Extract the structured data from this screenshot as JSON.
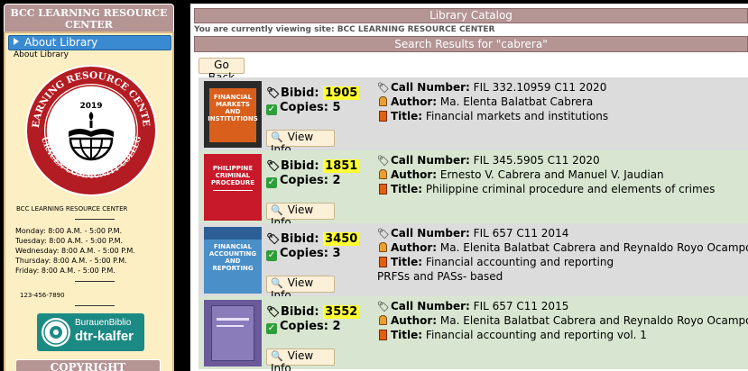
{
  "sidebar": {
    "title": "BCC LEARNING RESOURCE CENTER",
    "about_tab": "About Library",
    "about_link": "About Library",
    "logo_year": "2019",
    "logo_top_text": "LEARNING RESOURCE CENTER",
    "logo_bottom_text": "BURAUEN COMMUNITY COLLEGE",
    "center_name": "BCC LEARNING RESOURCE CENTER",
    "hours": [
      "Monday: 8:00 A.M. - 5:00 P.M.",
      "Tuesday: 8:00 A.M. - 5:00 P.M.",
      "Wednesday: 8:00 A.M. - 5:00 P.M.",
      "Thursday: 8:00 A.M. - 5:00 P.M.",
      "Friday: 8:00 A.M. - 5:00 P.M."
    ],
    "phone": "123-456-7890",
    "biblio_line1": "BurauenBiblio",
    "biblio_line2": "dtr-kalfer",
    "copyright": "COPYRIGHT"
  },
  "main": {
    "catalog_title": "Library Catalog",
    "viewing_text": "You are currently viewing site: BCC LEARNING RESOURCE CENTER",
    "results_title": "Search Results for \"cabrera\"",
    "go_back": "Go Back",
    "labels": {
      "bibid": "Bibid:",
      "copies": "Copies:",
      "call_number": "Call Number:",
      "author": "Author:",
      "title": "Title:",
      "view_info": "View Info"
    },
    "results": [
      {
        "bibid": "1905",
        "copies": "5",
        "call_number": "FIL 332.10959 C11 2020",
        "author": "Ma. Elenta Balatbat Cabrera",
        "title": "Financial markets and institutions",
        "extra": "",
        "cover_color": "#d8601c",
        "cover_text": "FINANCIAL MARKETS AND INSTITUTIONS"
      },
      {
        "bibid": "1851",
        "copies": "2",
        "call_number": "FIL 345.5905 C11 2020",
        "author": "Ernesto V. Cabrera and Manuel V. Jaudian",
        "title": "Philippine criminal procedure and elements of crimes",
        "extra": "",
        "cover_color": "#c8192a",
        "cover_text": "PHILIPPINE CRIMINAL PROCEDURE"
      },
      {
        "bibid": "3450",
        "copies": "3",
        "call_number": "FIL 657 C11 2014",
        "author": "Ma. Elenita Balatbat Cabrera and Reynaldo Royo Ocampo",
        "title": "Financial accounting and reporting",
        "extra": "PRFSs and PASs- based",
        "cover_color": "#4a8fc8",
        "cover_text": "FINANCIAL ACCOUNTING AND REPORTING"
      },
      {
        "bibid": "3552",
        "copies": "2",
        "call_number": "FIL 657 C11 2015",
        "author": "Ma. Elenita Balatbat Cabrera and Reynaldo Royo Ocampo",
        "title": "Financial accounting and reporting vol. 1",
        "extra": "",
        "cover_color": "#6a5a9a",
        "cover_text": ""
      }
    ]
  },
  "colors": {
    "header_bar": "#b59494",
    "sidebar_bg": "#fdefc4",
    "row_gray": "#dcdcdc",
    "row_green": "#d8e6d1",
    "highlight": "#ffff33",
    "tab_blue": "#3a8ad2"
  }
}
